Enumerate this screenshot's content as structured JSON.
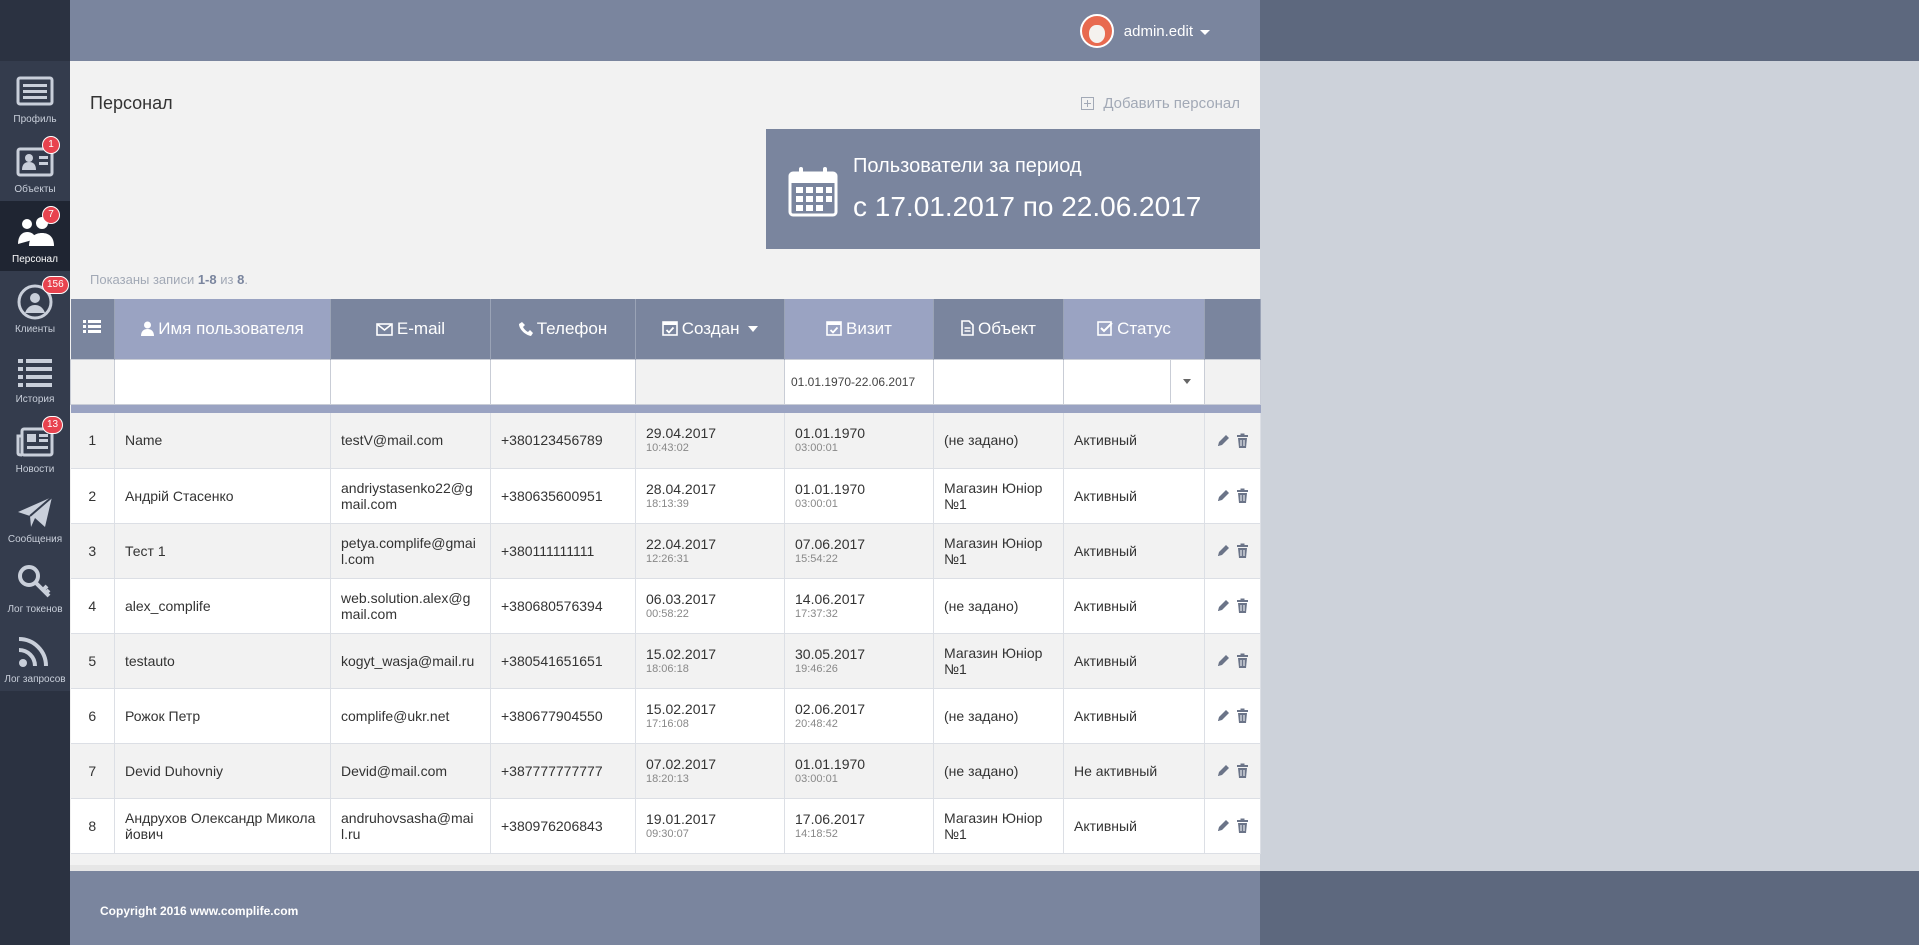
{
  "header": {
    "user_name": "admin.edit"
  },
  "sidebar": {
    "items": [
      {
        "label": "Профиль",
        "icon": "profile-card-icon",
        "badge": ""
      },
      {
        "label": "Объекты",
        "icon": "objects-icon",
        "badge": "1"
      },
      {
        "label": "Персонал",
        "icon": "staff-icon",
        "badge": "7",
        "active": true
      },
      {
        "label": "Клиенты",
        "icon": "clients-icon",
        "badge": "156"
      },
      {
        "label": "История",
        "icon": "history-list-icon",
        "badge": ""
      },
      {
        "label": "Новости",
        "icon": "news-icon",
        "badge": "13"
      },
      {
        "label": "Сообщения",
        "icon": "paper-plane-icon",
        "badge": ""
      },
      {
        "label": "Лог токенов",
        "icon": "key-icon",
        "badge": ""
      },
      {
        "label": "Лог запросов",
        "icon": "rss-icon",
        "badge": ""
      }
    ]
  },
  "page": {
    "title": "Персонал",
    "add_label": "Добавить персонал",
    "period_label": "Пользователи за период",
    "period_value": "с 17.01.2017 по 22.06.2017",
    "summary_prefix": "Показаны записи ",
    "summary_range": "1-8",
    "summary_mid": " из ",
    "summary_total": "8",
    "summary_suffix": "."
  },
  "table": {
    "columns": {
      "name": "Имя пользователя",
      "email": "E-mail",
      "phone": "Телефон",
      "created": "Создан",
      "visit": "Визит",
      "object": "Объект",
      "status": "Статус"
    },
    "filters": {
      "visit": "01.01.1970-22.06.2017"
    },
    "rows": [
      {
        "n": "1",
        "name": "Name",
        "email": "testV@mail.com",
        "phone": "+380123456789",
        "created_date": "29.04.2017",
        "created_time": "10:43:02",
        "visit_date": "01.01.1970",
        "visit_time": "03:00:01",
        "object": "(не задано)",
        "status": "Активный"
      },
      {
        "n": "2",
        "name": "Андрій Стасенко",
        "email": "andriystasenko22@gmail.com",
        "phone": "+380635600951",
        "created_date": "28.04.2017",
        "created_time": "18:13:39",
        "visit_date": "01.01.1970",
        "visit_time": "03:00:01",
        "object": "Магазин Юніор №1",
        "status": "Активный"
      },
      {
        "n": "3",
        "name": "Тест 1",
        "email": "petya.complife@gmail.com",
        "phone": "+380111111111",
        "created_date": "22.04.2017",
        "created_time": "12:26:31",
        "visit_date": "07.06.2017",
        "visit_time": "15:54:22",
        "object": "Магазин Юніор №1",
        "status": "Активный"
      },
      {
        "n": "4",
        "name": "alex_complife",
        "email": "web.solution.alex@gmail.com",
        "phone": "+380680576394",
        "created_date": "06.03.2017",
        "created_time": "00:58:22",
        "visit_date": "14.06.2017",
        "visit_time": "17:37:32",
        "object": "(не задано)",
        "status": "Активный"
      },
      {
        "n": "5",
        "name": "testauto",
        "email": "kogyt_wasja@mail.ru",
        "phone": "+380541651651",
        "created_date": "15.02.2017",
        "created_time": "18:06:18",
        "visit_date": "30.05.2017",
        "visit_time": "19:46:26",
        "object": "Магазин Юніор №1",
        "status": "Активный"
      },
      {
        "n": "6",
        "name": "Рожок Петр",
        "email": "complife@ukr.net",
        "phone": "+380677904550",
        "created_date": "15.02.2017",
        "created_time": "17:16:08",
        "visit_date": "02.06.2017",
        "visit_time": "20:48:42",
        "object": "(не задано)",
        "status": "Активный"
      },
      {
        "n": "7",
        "name": "Devid Duhovniy",
        "email": "Devid@mail.com",
        "phone": "+387777777777",
        "created_date": "07.02.2017",
        "created_time": "18:20:13",
        "visit_date": "01.01.1970",
        "visit_time": "03:00:01",
        "object": "(не задано)",
        "status": "Не активный"
      },
      {
        "n": "8",
        "name": "Андрухов Олександр Миколайович",
        "email": "andruhovsasha@mail.ru",
        "phone": "+380976206843",
        "created_date": "19.01.2017",
        "created_time": "09:30:07",
        "visit_date": "17.06.2017",
        "visit_time": "14:18:52",
        "object": "Магазин Юніор №1",
        "status": "Активный"
      }
    ]
  },
  "footer": {
    "copyright": "Copyright 2016 www.complife.com"
  }
}
